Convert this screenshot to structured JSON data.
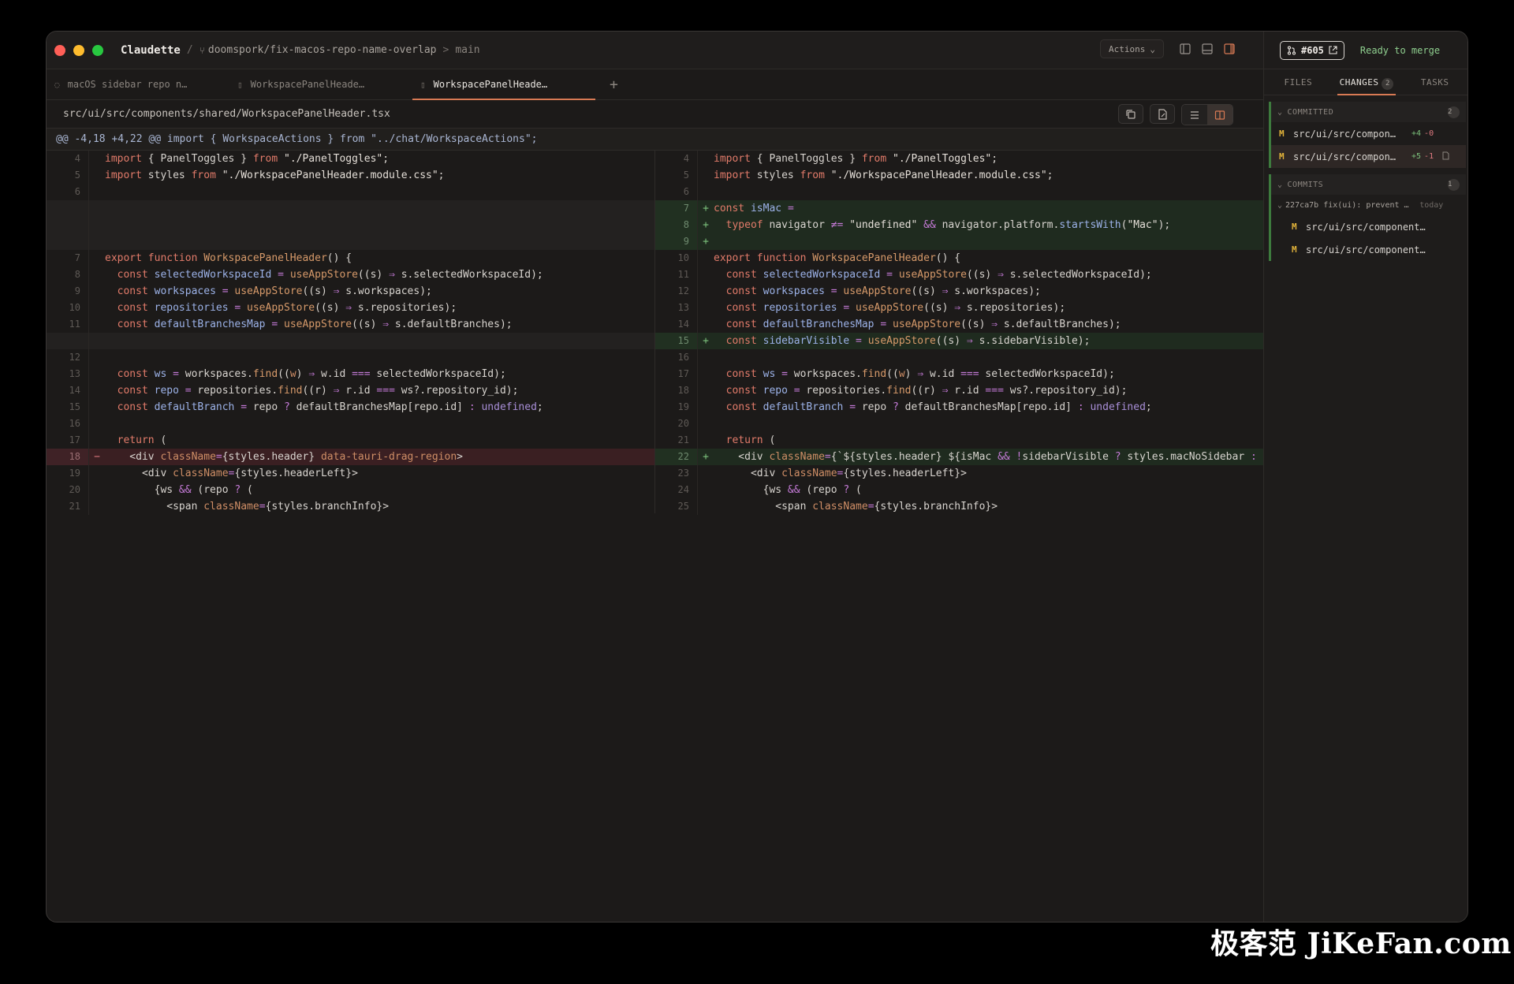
{
  "titlebar": {
    "app_name": "Claudette",
    "sep": "/",
    "branch": "doomspork/fix-macos-repo-name-overlap",
    "base_sep": ">",
    "base_branch": "main",
    "actions_label": "Actions"
  },
  "tabs": [
    {
      "label": "macOS sidebar repo n…",
      "active": false
    },
    {
      "label": "WorkspacePanelHeade…",
      "active": false
    },
    {
      "label": "WorkspacePanelHeade…",
      "active": true
    }
  ],
  "tab_add": "+",
  "file_path": "src/ui/src/components/shared/WorkspacePanelHeader.tsx",
  "hunk_header": "@@ -4,18 +4,22 @@ import { WorkspaceActions } from \"../chat/WorkspaceActions\";",
  "sidebar": {
    "pr_number": "#605",
    "status": "Ready to merge",
    "tabs": [
      {
        "label": "FILES",
        "count": ""
      },
      {
        "label": "CHANGES",
        "count": "2"
      },
      {
        "label": "TASKS",
        "count": ""
      }
    ],
    "committed": {
      "title": "COMMITTED",
      "count": "2",
      "files": [
        {
          "badge": "M",
          "name": "src/ui/src/compon…",
          "adds": "+4",
          "dels": "-0"
        },
        {
          "badge": "M",
          "name": "src/ui/src/compon…",
          "adds": "+5",
          "dels": "-1"
        }
      ]
    },
    "commits": {
      "title": "COMMITS",
      "count": "1",
      "hash": "227ca7b",
      "message": "fix(ui): prevent …",
      "when": "today",
      "files": [
        {
          "badge": "M",
          "name": "src/ui/src/component…"
        },
        {
          "badge": "M",
          "name": "src/ui/src/component…"
        }
      ]
    }
  },
  "watermark": "极客范 JiKeFan.com",
  "colors": {
    "accent": "#d87a54",
    "added": "#7cc27c",
    "removed": "#e07a80",
    "modified_badge": "#e0b23a"
  }
}
